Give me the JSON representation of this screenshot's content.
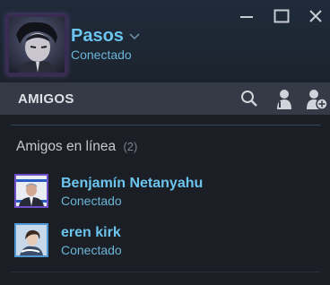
{
  "header": {
    "username": "Pasos",
    "status": "Conectado"
  },
  "window_controls": {
    "minimize_icon": "minimize-icon",
    "maximize_icon": "maximize-icon",
    "close_icon": "close-icon"
  },
  "friends_bar": {
    "title": "AMIGOS",
    "icons": [
      "search-icon",
      "user-icon",
      "add-friend-icon"
    ]
  },
  "online_group": {
    "label": "Amigos en línea",
    "count": "(2)"
  },
  "friends": [
    {
      "name": "Benjamín Netanyahu",
      "status": "Conectado"
    },
    {
      "name": "eren kirk",
      "status": "Conectado"
    }
  ],
  "colors": {
    "accent_name": "#6bc5ef",
    "status_online": "#6bb5d8",
    "bar_bg": "#353b46",
    "window_bg": "#1b1e24"
  }
}
